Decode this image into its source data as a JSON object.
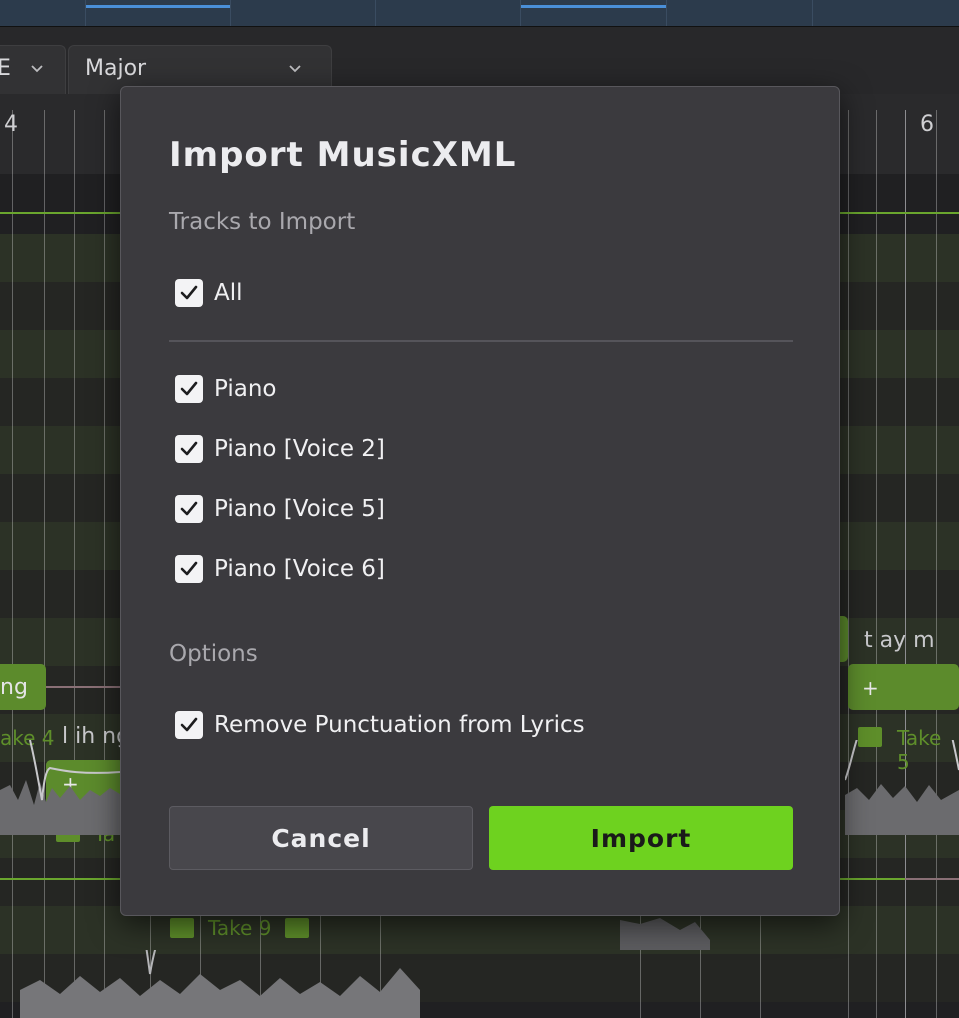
{
  "toolbar": {
    "key_partial": "E",
    "scale": "Major"
  },
  "ruler": {
    "left_bar": "4",
    "right_bar": "6"
  },
  "notes": {
    "left_lyric": "ng",
    "mid_lyric": "l ih ng",
    "right_lyric": "t ay m",
    "take_left": "ake 4",
    "take_mid": "Ta",
    "take_bottom": "Take 9",
    "take_right": "Take 5",
    "plus": "+"
  },
  "dialog": {
    "title": "Import MusicXML",
    "tracks_label": "Tracks to Import",
    "all_label": "All",
    "tracks": [
      {
        "label": "Piano",
        "checked": true
      },
      {
        "label": "Piano [Voice 2]",
        "checked": true
      },
      {
        "label": "Piano [Voice 5]",
        "checked": true
      },
      {
        "label": "Piano [Voice 6]",
        "checked": true
      }
    ],
    "options_label": "Options",
    "remove_punct_label": "Remove Punctuation from Lyrics",
    "cancel_label": "Cancel",
    "import_label": "Import"
  },
  "colors": {
    "accent_green": "#6ed21f",
    "dialog_bg": "#3b3a3e",
    "note_green": "#5c8b2c"
  },
  "icons": {
    "checkbox": "checkmark-icon",
    "dropdown": "chevron-down-icon",
    "take": "clapperboard-icon"
  }
}
